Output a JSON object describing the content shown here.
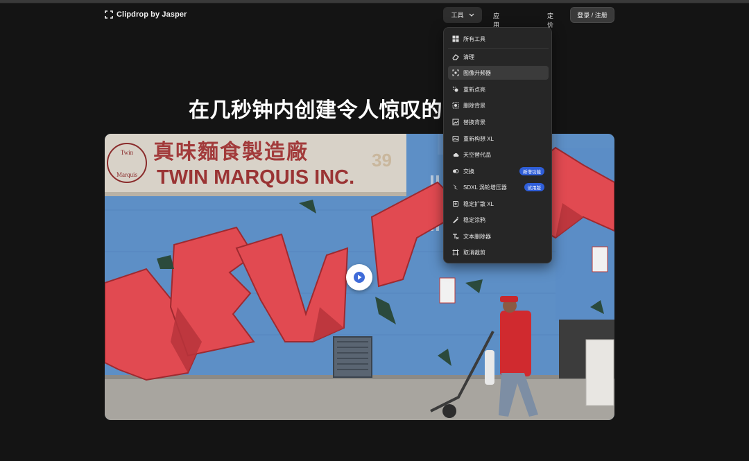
{
  "brand": {
    "logo_text": "Clipdrop by Jasper",
    "icon": "bracket-logo-icon"
  },
  "nav": {
    "tools_label": "工具",
    "api_label": "应用程序接口",
    "pricing_label": "定价",
    "login_label": "登录 / 注册"
  },
  "headline": "在几秒钟内创建令人惊叹的",
  "hero": {
    "sign_cn": "真味麵食製造廠",
    "sign_en": "TWIN MARQUIS INC.",
    "sign_number": "39",
    "sign_logo_line1": "Twin",
    "sign_logo_line2": "Marquis",
    "play_icon": "play-icon"
  },
  "menu": {
    "items": [
      {
        "label": "所有工具",
        "icon": "grid-icon"
      },
      {
        "label": "清理",
        "icon": "eraser-icon"
      },
      {
        "label": "图像升频器",
        "icon": "upscale-icon"
      },
      {
        "label": "重新点亮",
        "icon": "light-icon"
      },
      {
        "label": "删除背景",
        "icon": "remove-bg-icon"
      },
      {
        "label": "替换背景",
        "icon": "replace-bg-icon"
      },
      {
        "label": "重新构想 XL",
        "icon": "reimagine-icon"
      },
      {
        "label": "天空替代品",
        "icon": "sky-icon"
      },
      {
        "label": "交换",
        "icon": "swap-icon",
        "badge": "新增功能"
      },
      {
        "label": "SDXL 涡轮增压器",
        "icon": "turbo-icon",
        "badge": "试用版"
      },
      {
        "label": "稳定扩散 XL",
        "icon": "diffusion-icon"
      },
      {
        "label": "稳定涂鸦",
        "icon": "doodle-icon"
      },
      {
        "label": "文本删除器",
        "icon": "text-remover-icon"
      },
      {
        "label": "取消裁剪",
        "icon": "uncrop-icon"
      }
    ]
  }
}
